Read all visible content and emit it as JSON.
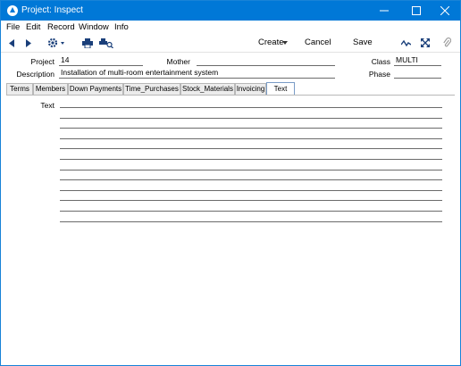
{
  "window": {
    "title": "Project: Inspect",
    "minimize_label": "",
    "maximize_label": "",
    "close_label": ""
  },
  "menu": {
    "items": [
      "File",
      "Edit",
      "Record",
      "Window",
      "Info"
    ]
  },
  "toolbar": {
    "prev_icon": "triangle-left-icon",
    "next_icon": "triangle-right-icon",
    "operations_icon": "gear-icon",
    "print_icon": "printer-icon",
    "print_preview_icon": "print-preview-icon",
    "create_label": "Create",
    "cancel_label": "Cancel",
    "save_label": "Save",
    "pulse_icon": "activity-icon",
    "expand_icon": "expand-arrows-icon",
    "attach_icon": "paperclip-icon"
  },
  "form": {
    "project_label": "Project",
    "project_value": "14",
    "mother_label": "Mother",
    "mother_value": "",
    "class_label": "Class",
    "class_value": "MULTI",
    "description_label": "Description",
    "description_value": "Installation of multi-room entertainment system",
    "phase_label": "Phase",
    "phase_value": ""
  },
  "tabs": [
    {
      "label": "Terms",
      "active": false
    },
    {
      "label": "Members",
      "active": false
    },
    {
      "label": "Down Payments",
      "active": false
    },
    {
      "label": "Time_Purchases",
      "active": false
    },
    {
      "label": "Stock_Materials",
      "active": false
    },
    {
      "label": "Invoicing",
      "active": false
    },
    {
      "label": "Text",
      "active": true
    }
  ],
  "text_card": {
    "label": "Text",
    "line_count": 12
  },
  "colors": {
    "titlebar": "#0078d7",
    "active_tab_border": "#7a9cc6"
  }
}
